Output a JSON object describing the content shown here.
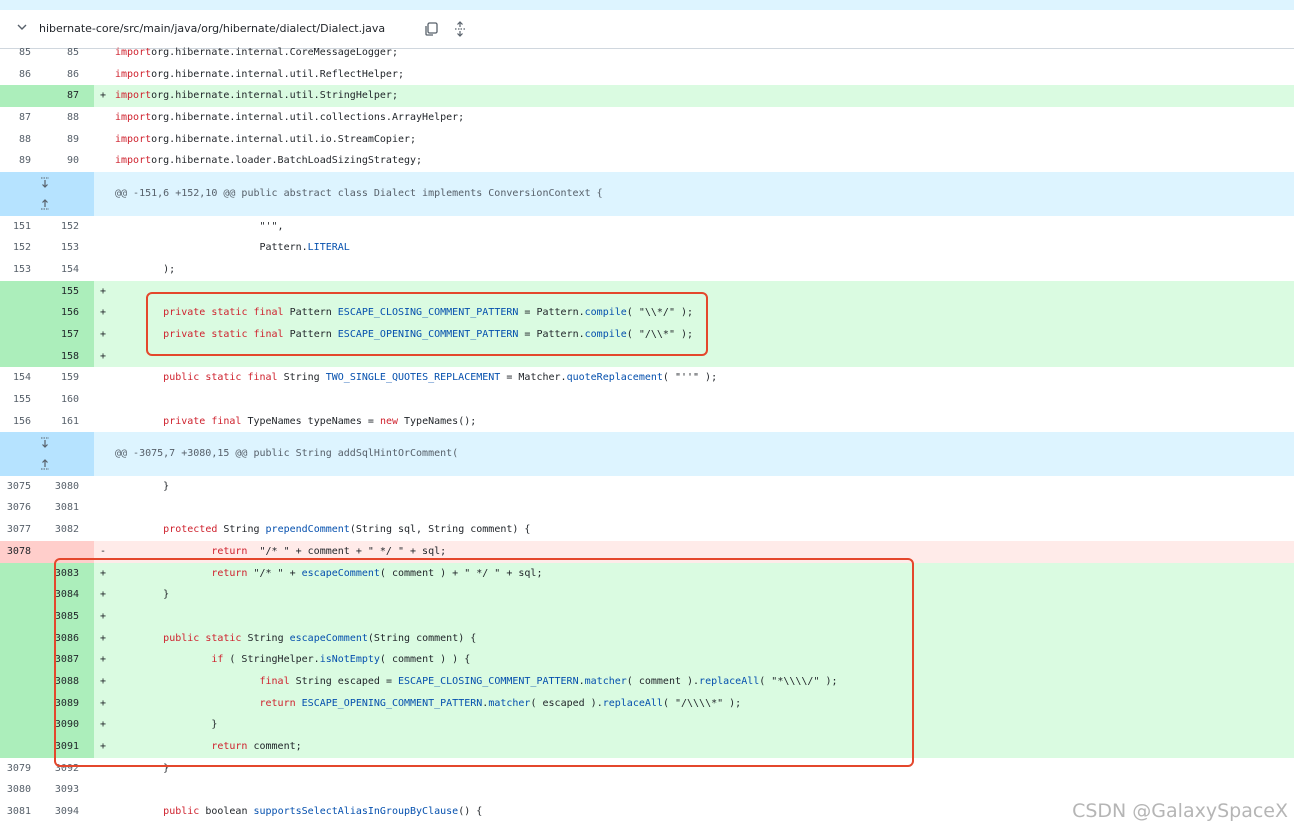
{
  "file": {
    "path": "hibernate-core/src/main/java/org/hibernate/dialect/Dialect.java",
    "icons": [
      "chevron-down-icon",
      "copy-icon",
      "expand-all-icon"
    ]
  },
  "rows": [
    {
      "type": "ctx",
      "l": "85",
      "r": "85",
      "s": "",
      "code": [
        [
          "kw",
          "import"
        ],
        [
          "",
          "org.hibernate.internal.CoreMessageLogger;"
        ]
      ]
    },
    {
      "type": "ctx",
      "l": "86",
      "r": "86",
      "s": "",
      "code": [
        [
          "kw",
          "import"
        ],
        [
          "",
          "org.hibernate.internal.util.ReflectHelper;"
        ]
      ]
    },
    {
      "type": "add",
      "l": "",
      "r": "87",
      "s": "+",
      "code": [
        [
          "kw",
          "import"
        ],
        [
          "",
          "org.hibernate.internal.util.StringHelper;"
        ]
      ]
    },
    {
      "type": "ctx",
      "l": "87",
      "r": "88",
      "s": "",
      "code": [
        [
          "kw",
          "import"
        ],
        [
          "",
          "org.hibernate.internal.util.collections.ArrayHelper;"
        ]
      ]
    },
    {
      "type": "ctx",
      "l": "88",
      "r": "89",
      "s": "",
      "code": [
        [
          "kw",
          "import"
        ],
        [
          "",
          "org.hibernate.internal.util.io.StreamCopier;"
        ]
      ]
    },
    {
      "type": "ctx",
      "l": "89",
      "r": "90",
      "s": "",
      "code": [
        [
          "kw",
          "import"
        ],
        [
          "",
          "org.hibernate.loader.BatchLoadSizingStrategy;"
        ]
      ]
    },
    {
      "type": "hunk",
      "text": "@@ -151,6 +152,10 @@ public abstract class Dialect implements ConversionContext {"
    },
    {
      "type": "ctx",
      "l": "151",
      "r": "152",
      "s": "",
      "code": [
        [
          "",
          "                        \"'\","
        ]
      ]
    },
    {
      "type": "ctx",
      "l": "152",
      "r": "153",
      "s": "",
      "code": [
        [
          "",
          "                        Pattern."
        ],
        [
          "fn",
          "LITERAL"
        ]
      ]
    },
    {
      "type": "ctx",
      "l": "153",
      "r": "154",
      "s": "",
      "code": [
        [
          "",
          "        );"
        ]
      ]
    },
    {
      "type": "add",
      "l": "",
      "r": "155",
      "s": "+",
      "code": [
        [
          "",
          ""
        ]
      ]
    },
    {
      "type": "add",
      "l": "",
      "r": "156",
      "s": "+",
      "code": [
        [
          "",
          "        "
        ],
        [
          "kw",
          "private static final"
        ],
        [
          "",
          " Pattern "
        ],
        [
          "fn",
          "ESCAPE_CLOSING_COMMENT_PATTERN"
        ],
        [
          "",
          " = Pattern."
        ],
        [
          "fn",
          "compile"
        ],
        [
          "",
          "( \"\\\\*/\" );"
        ]
      ]
    },
    {
      "type": "add",
      "l": "",
      "r": "157",
      "s": "+",
      "code": [
        [
          "",
          "        "
        ],
        [
          "kw",
          "private static final"
        ],
        [
          "",
          " Pattern "
        ],
        [
          "fn",
          "ESCAPE_OPENING_COMMENT_PATTERN"
        ],
        [
          "",
          " = Pattern."
        ],
        [
          "fn",
          "compile"
        ],
        [
          "",
          "( \"/\\\\*\" );"
        ]
      ]
    },
    {
      "type": "add",
      "l": "",
      "r": "158",
      "s": "+",
      "code": [
        [
          "",
          ""
        ]
      ]
    },
    {
      "type": "ctx",
      "l": "154",
      "r": "159",
      "s": "",
      "code": [
        [
          "",
          "        "
        ],
        [
          "kw",
          "public static final"
        ],
        [
          "",
          " String "
        ],
        [
          "fn",
          "TWO_SINGLE_QUOTES_REPLACEMENT"
        ],
        [
          "",
          " = Matcher."
        ],
        [
          "fn",
          "quoteReplacement"
        ],
        [
          "",
          "( \"''\" );"
        ]
      ]
    },
    {
      "type": "ctx",
      "l": "155",
      "r": "160",
      "s": "",
      "code": [
        [
          "",
          ""
        ]
      ]
    },
    {
      "type": "ctx",
      "l": "156",
      "r": "161",
      "s": "",
      "code": [
        [
          "",
          "        "
        ],
        [
          "kw",
          "private final"
        ],
        [
          "",
          " TypeNames typeNames = "
        ],
        [
          "kw",
          "new"
        ],
        [
          "",
          " TypeNames();"
        ]
      ]
    },
    {
      "type": "hunk",
      "text": "@@ -3075,7 +3080,15 @@ public String addSqlHintOrComment("
    },
    {
      "type": "ctx",
      "l": "3075",
      "r": "3080",
      "s": "",
      "code": [
        [
          "",
          "        }"
        ]
      ]
    },
    {
      "type": "ctx",
      "l": "3076",
      "r": "3081",
      "s": "",
      "code": [
        [
          "",
          ""
        ]
      ]
    },
    {
      "type": "ctx",
      "l": "3077",
      "r": "3082",
      "s": "",
      "code": [
        [
          "",
          "        "
        ],
        [
          "kw",
          "protected"
        ],
        [
          "",
          " String "
        ],
        [
          "fn",
          "prependComment"
        ],
        [
          "",
          "(String sql, String comment) {"
        ]
      ]
    },
    {
      "type": "del",
      "l": "3078",
      "r": "",
      "s": "-",
      "code": [
        [
          "",
          "                "
        ],
        [
          "kw",
          "return"
        ],
        [
          "",
          "  \"/* \" + comment + \" */ \" + sql;"
        ]
      ]
    },
    {
      "type": "add",
      "l": "",
      "r": "3083",
      "s": "+",
      "code": [
        [
          "",
          "                "
        ],
        [
          "kw",
          "return"
        ],
        [
          "",
          " \"/* \" + "
        ],
        [
          "fn",
          "escapeComment"
        ],
        [
          "",
          "( comment ) + \" */ \" + sql;"
        ]
      ]
    },
    {
      "type": "add",
      "l": "",
      "r": "3084",
      "s": "+",
      "code": [
        [
          "",
          "        }"
        ]
      ]
    },
    {
      "type": "add",
      "l": "",
      "r": "3085",
      "s": "+",
      "code": [
        [
          "",
          ""
        ]
      ]
    },
    {
      "type": "add",
      "l": "",
      "r": "3086",
      "s": "+",
      "code": [
        [
          "",
          "        "
        ],
        [
          "kw",
          "public static"
        ],
        [
          "",
          " String "
        ],
        [
          "fn",
          "escapeComment"
        ],
        [
          "",
          "(String comment) {"
        ]
      ]
    },
    {
      "type": "add",
      "l": "",
      "r": "3087",
      "s": "+",
      "code": [
        [
          "",
          "                "
        ],
        [
          "kw",
          "if"
        ],
        [
          "",
          " ( StringHelper."
        ],
        [
          "fn",
          "isNotEmpty"
        ],
        [
          "",
          "( comment ) ) {"
        ]
      ]
    },
    {
      "type": "add",
      "l": "",
      "r": "3088",
      "s": "+",
      "code": [
        [
          "",
          "                        "
        ],
        [
          "kw",
          "final"
        ],
        [
          "",
          " String escaped = "
        ],
        [
          "fn",
          "ESCAPE_CLOSING_COMMENT_PATTERN"
        ],
        [
          "",
          "."
        ],
        [
          "fn",
          "matcher"
        ],
        [
          "",
          "( comment )."
        ],
        [
          "fn",
          "replaceAll"
        ],
        [
          "",
          "( \"*\\\\\\\\/\" );"
        ]
      ]
    },
    {
      "type": "add",
      "l": "",
      "r": "3089",
      "s": "+",
      "code": [
        [
          "",
          "                        "
        ],
        [
          "kw",
          "return"
        ],
        [
          "",
          " "
        ],
        [
          "fn",
          "ESCAPE_OPENING_COMMENT_PATTERN"
        ],
        [
          "",
          "."
        ],
        [
          "fn",
          "matcher"
        ],
        [
          "",
          "( escaped )."
        ],
        [
          "fn",
          "replaceAll"
        ],
        [
          "",
          "( \"/\\\\\\\\*\" );"
        ]
      ]
    },
    {
      "type": "add",
      "l": "",
      "r": "3090",
      "s": "+",
      "code": [
        [
          "",
          "                }"
        ]
      ]
    },
    {
      "type": "add",
      "l": "",
      "r": "3091",
      "s": "+",
      "code": [
        [
          "",
          "                "
        ],
        [
          "kw",
          "return"
        ],
        [
          "",
          " comment;"
        ]
      ]
    },
    {
      "type": "ctx",
      "l": "3079",
      "r": "3092",
      "s": "",
      "code": [
        [
          "",
          "        }"
        ]
      ]
    },
    {
      "type": "ctx",
      "l": "3080",
      "r": "3093",
      "s": "",
      "code": [
        [
          "",
          ""
        ]
      ]
    },
    {
      "type": "ctx",
      "l": "3081",
      "r": "3094",
      "s": "",
      "code": [
        [
          "",
          "        "
        ],
        [
          "kw",
          "public"
        ],
        [
          "",
          " boolean "
        ],
        [
          "fn",
          "supportsSelectAliasInGroupByClause"
        ],
        [
          "",
          "() {"
        ]
      ]
    }
  ],
  "watermark": "CSDN @GalaxySpaceX",
  "colors": {
    "add_bg": "#dafbe1",
    "add_gutter": "#aceebb",
    "del_bg": "#ffebe9",
    "hunk_bg": "#ddf4ff",
    "keyword": "#cf222e",
    "entity": "#0550ae",
    "annotation_box": "#e4472c"
  }
}
